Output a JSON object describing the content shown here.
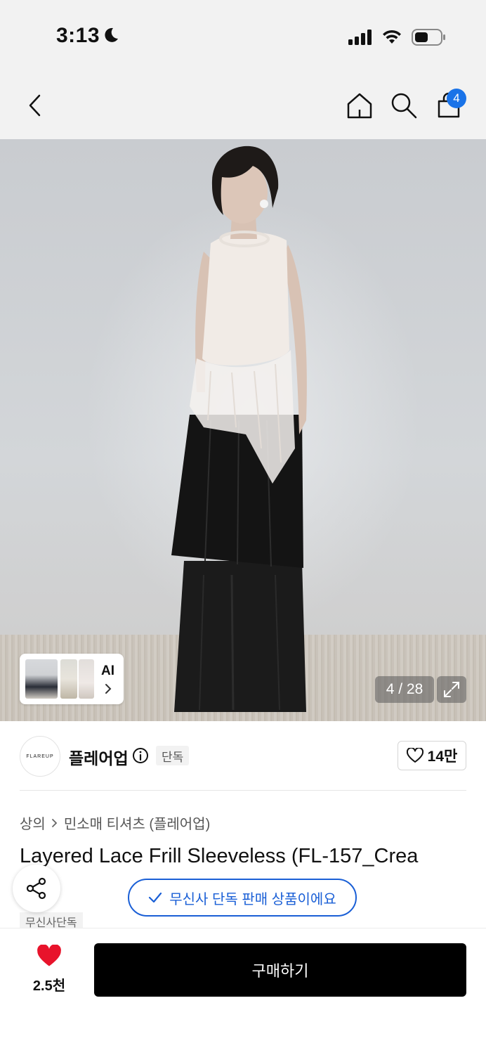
{
  "status_bar": {
    "time": "3:13"
  },
  "nav": {
    "cart_count": "4"
  },
  "gallery": {
    "ai_label": "AI",
    "counter": "4 / 28"
  },
  "brand": {
    "logo_text": "FLAREUP",
    "name": "플레어업",
    "exclusive_tag": "단독",
    "like_count": "14만"
  },
  "breadcrumb": {
    "category": "상의",
    "subcategory": "민소매 티셔츠 (플레어업)"
  },
  "product": {
    "title": "Layered Lace Frill Sleeveless (FL-157_Crea",
    "musinsa_tag": "무신사단독",
    "exclusive_banner": "무신사 단독 판매 상품이에요"
  },
  "bottom": {
    "heart_count": "2.5천",
    "buy_label": "구매하기"
  },
  "colors": {
    "accent_blue": "#1a5fd6",
    "badge_blue": "#1a73e8",
    "heart_red": "#e8132b",
    "buy_black": "#000000"
  }
}
